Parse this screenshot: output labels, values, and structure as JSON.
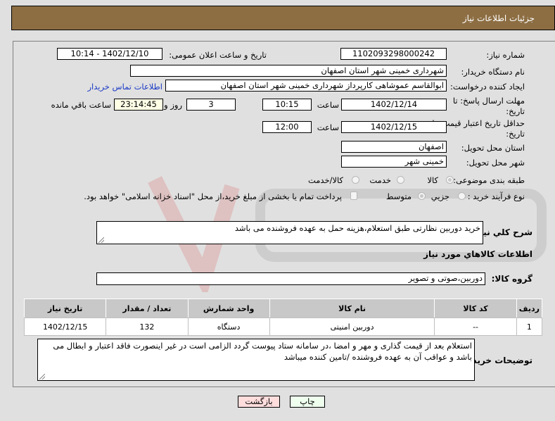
{
  "header": {
    "title": "جزئیات اطلاعات نیاز"
  },
  "form": {
    "need_number_label": "شماره نیاز:",
    "need_number": "1102093298000242",
    "announce_label": "تاریخ و ساعت اعلان عمومی:",
    "announce_value": "1402/12/10 - 10:14",
    "buyer_org_label": "نام دستگاه خریدار:",
    "buyer_org": "شهرداری خمینی شهر استان اصفهان",
    "requester_label": "ایجاد کننده درخواست:",
    "requester": "ابوالقاسم عموشاهی کارپرداز شهرداری خمینی شهر استان اصفهان",
    "contact_link": "اطلاعات تماس خریدار",
    "deadline_label_1": "مهلت ارسال پاسخ: تا",
    "deadline_label_2": "تاریخ:",
    "deadline_date": "1402/12/14",
    "time_label": "ساعت",
    "deadline_time": "10:15",
    "days_value": "3",
    "days_label": "روز و",
    "remaining_time": "23:14:45",
    "remaining_label": "ساعت باقي مانده",
    "validity_label_1": "حداقل تاریخ اعتبار قیمت: تا",
    "validity_label_2": "تاریخ:",
    "validity_date": "1402/12/15",
    "validity_time": "12:00",
    "province_label": "استان محل تحویل:",
    "province": "اصفهان",
    "city_label": "شهر محل تحویل:",
    "city": "خمینی شهر",
    "category_label": "طبقه بندی موضوعی:",
    "category_options": [
      "کالا",
      "خدمت",
      "کالا/خدمت"
    ],
    "category_selected": "کالا",
    "process_label": "نوع فرآیند خرید :",
    "process_options": [
      "جزیي",
      "متوسط"
    ],
    "process_selected": "متوسط",
    "treasury_text": "پرداخت تمام یا بخشی از مبلغ خرید،از محل \"اسناد خزانه اسلامی\" خواهد بود.",
    "description_label": "شرح کلي نیاز:",
    "description": "خرید دوربین نظارتی طبق استعلام،هزینه حمل به عهده فروشنده می باشد",
    "goods_section_title": "اطلاعات کالاهاي مورد نیاز",
    "goods_group_label": "گروه کالا:",
    "goods_group": "دوربین،صوتی و تصویر"
  },
  "table": {
    "headers": [
      "ردیف",
      "کد کالا",
      "نام کالا",
      "واحد شمارش",
      "تعداد / مقدار",
      "تاریخ نیاز"
    ],
    "rows": [
      [
        "1",
        "--",
        "دوربین امنیتی",
        "دستگاه",
        "132",
        "1402/12/15"
      ]
    ]
  },
  "buyer_notes": {
    "label": "توضیحات خریدار:",
    "text": "استعلام بعد از قیمت گذاری و مهر و امضا ،در سامانه ستاد پیوست گردد الزامی است در غیر اینصورت فاقد اعتبار و ابطال می باشد و عواقب آن به عهده فروشنده /تامین کننده میباشد"
  },
  "buttons": {
    "print": "چاپ",
    "back": "بازگشت"
  },
  "colors": {
    "header_bg": "#8d6e43",
    "link": "#1a39c5",
    "print_bg": "#eeffee",
    "back_bg": "#ffdddd"
  }
}
